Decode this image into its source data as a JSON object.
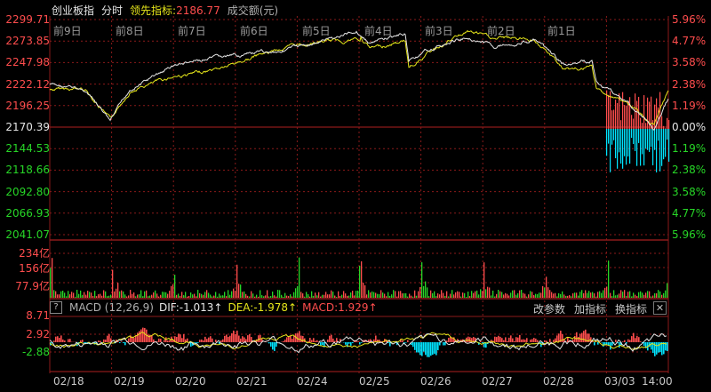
{
  "header": {
    "name": "创业板指",
    "mode": "分时",
    "leading_label": "领先指标:",
    "leading_value": "2186.77",
    "volume_label": "成交额(元)"
  },
  "price_axis_left": [
    "2299.71",
    "2273.85",
    "2247.98",
    "2222.12",
    "2196.25",
    "2170.39",
    "2144.53",
    "2118.66",
    "2092.80",
    "2066.93",
    "2041.07"
  ],
  "price_axis_right": [
    "5.96%",
    "4.77%",
    "3.58%",
    "2.38%",
    "1.19%",
    "0.00%",
    "1.19%",
    "2.38%",
    "3.58%",
    "4.77%",
    "5.96%"
  ],
  "day_labels": [
    "前9日",
    "前8日",
    "前7日",
    "前6日",
    "前5日",
    "前4日",
    "前3日",
    "前2日",
    "前1日"
  ],
  "volume_axis": [
    "234亿",
    "156亿",
    "77.9亿"
  ],
  "macd_bar": {
    "help": "?",
    "title": "MACD (12,26,9)",
    "dif": "DIF:-1.013↑",
    "dea": "DEA:-1.978↑",
    "macd": "MACD:1.929↑",
    "btn_params": "改参数",
    "btn_add": "加指标",
    "btn_switch": "换指标",
    "btn_close": "✕"
  },
  "macd_axis": [
    "8.71",
    "2.92",
    "-2.88"
  ],
  "dates": [
    "02/18",
    "02/19",
    "02/20",
    "02/21",
    "02/24",
    "02/25",
    "02/26",
    "02/27",
    "02/28",
    "03/03",
    "14:00"
  ],
  "colors": {
    "red": "#ff4d4d",
    "green": "#27d627",
    "white": "#e6e6e6",
    "yellow": "#e5e51a",
    "cyan": "#00e5ff",
    "grid": "#8b1a1a"
  },
  "chart_data": {
    "type": "line",
    "title": "创业板指 分时",
    "ylim": [
      2041.07,
      2299.71
    ],
    "base": 2170.39,
    "series": [
      {
        "name": "创业板指"
      },
      {
        "name": "领先指标",
        "last": 2186.77
      }
    ]
  }
}
